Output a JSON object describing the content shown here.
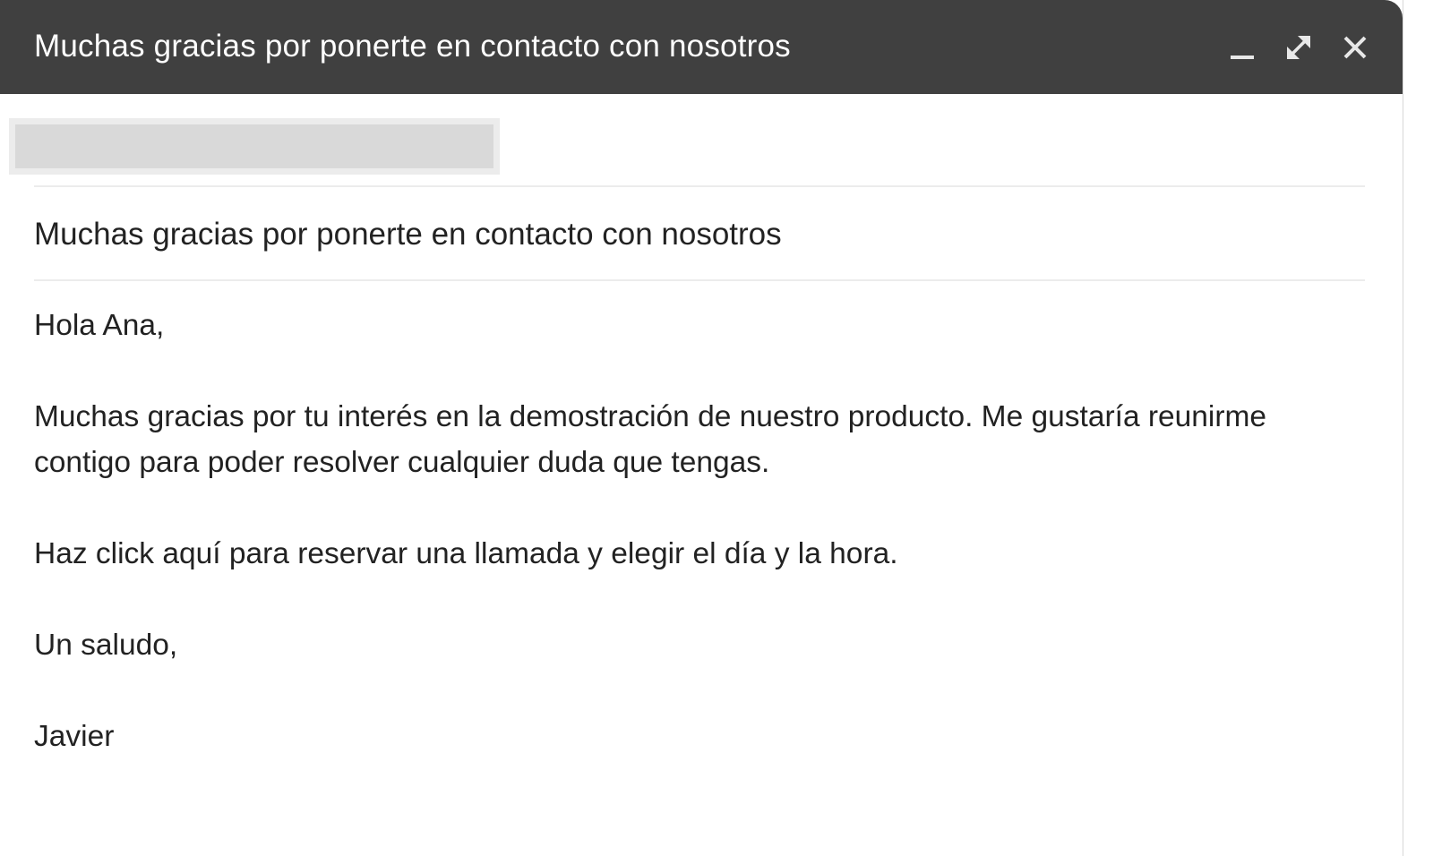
{
  "window": {
    "title": "Muchas gracias por ponerte en contacto con nosotros",
    "controls": {
      "minimize_icon": "minimize-icon",
      "expand_icon": "expand-icon",
      "close_icon": "close-icon"
    }
  },
  "recipient": {
    "redacted": true
  },
  "subject": "Muchas gracias por ponerte en contacto con nosotros",
  "body": {
    "greeting": "Hola Ana,",
    "paragraph_1": "Muchas gracias por tu interés en la demostración de nuestro producto. Me gustaría reunirme contigo para poder resolver cualquier duda que tengas.",
    "paragraph_2": "Haz click aquí para reservar una llamada y elegir el día y la hora.",
    "closing": "Un saludo,",
    "signature": "Javier"
  },
  "colors": {
    "title_bar": "#404040",
    "title_text": "#ffffff",
    "body_text": "#222222",
    "divider": "#ececec",
    "redaction": "#d9d9d9"
  }
}
